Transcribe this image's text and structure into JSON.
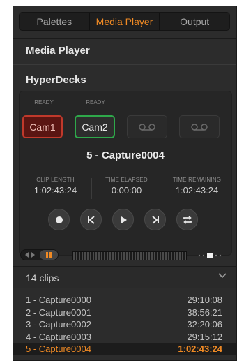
{
  "tabs": [
    {
      "label": "Palettes",
      "active": false
    },
    {
      "label": "Media Player",
      "active": true
    },
    {
      "label": "Output",
      "active": false
    }
  ],
  "sections": {
    "media_player": "Media Player",
    "hyperdecks": "HyperDecks"
  },
  "decks": [
    {
      "status": "READY",
      "label": "Cam1",
      "state": "recording",
      "color": "#c0392b"
    },
    {
      "status": "READY",
      "label": "Cam2",
      "state": "selected",
      "color": "#2ea84a"
    },
    {
      "status": "",
      "label": "",
      "state": "empty",
      "icon": "tape-icon"
    },
    {
      "status": "",
      "label": "",
      "state": "empty",
      "icon": "tape-icon"
    }
  ],
  "current_clip": "5 - Capture0004",
  "timecodes": {
    "clip_length_label": "CLIP LENGTH",
    "clip_length": "1:02:43:24",
    "time_elapsed_label": "TIME ELAPSED",
    "time_elapsed": "0:00:00",
    "time_remaining_label": "TIME REMAINING",
    "time_remaining": "1:02:43:24"
  },
  "transport": [
    "record-icon",
    "previous-icon",
    "play-icon",
    "next-icon",
    "loop-icon"
  ],
  "clips": {
    "count_label": "14 clips",
    "items": [
      {
        "name": "1 - Capture0000",
        "duration": "29:10:08"
      },
      {
        "name": "2 - Capture0001",
        "duration": "38:56:21"
      },
      {
        "name": "3 - Capture0002",
        "duration": "32:20:06"
      },
      {
        "name": "4 - Capture0003",
        "duration": "29:15:12"
      },
      {
        "name": "5 - Capture0004",
        "duration": "1:02:43:24",
        "selected": true
      }
    ]
  },
  "colors": {
    "accent": "#f08a24",
    "panel": "#2c2c2c",
    "record_red": "#c0392b",
    "selected_green": "#2ea84a"
  }
}
